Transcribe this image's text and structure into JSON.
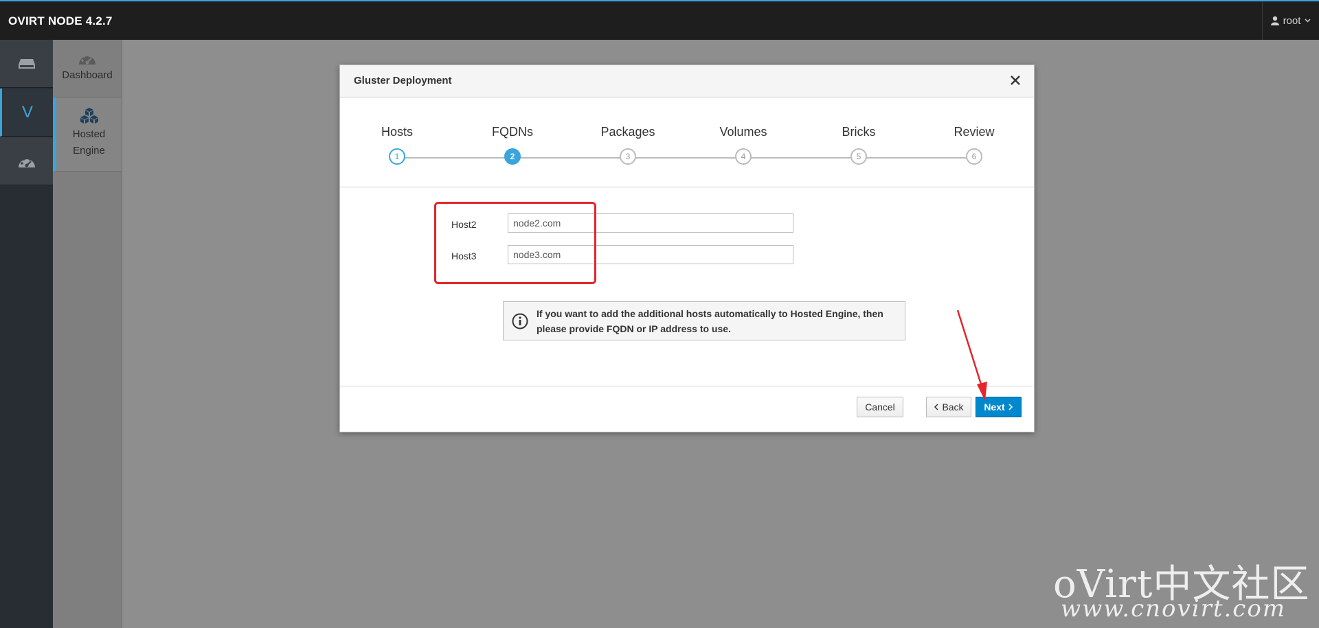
{
  "app": {
    "title": "OVIRT NODE 4.2.7",
    "user": "root"
  },
  "leftnav": {
    "items": [
      {
        "name": "host",
        "icon": "server-icon"
      },
      {
        "name": "virtualization",
        "label": "V"
      },
      {
        "name": "dashboard",
        "icon": "dashboard-icon"
      }
    ]
  },
  "subnav": {
    "items": [
      {
        "label": "Dashboard",
        "icon": "dashboard-icon"
      },
      {
        "label": "Hosted Engine",
        "line1": "Hosted",
        "line2": "Engine",
        "icon": "cubes-icon",
        "active": true
      }
    ]
  },
  "modal": {
    "title": "Gluster Deployment",
    "steps": [
      {
        "label": "Hosts",
        "number": "1",
        "state": "done"
      },
      {
        "label": "FQDNs",
        "number": "2",
        "state": "active"
      },
      {
        "label": "Packages",
        "number": "3",
        "state": "pending"
      },
      {
        "label": "Volumes",
        "number": "4",
        "state": "pending"
      },
      {
        "label": "Bricks",
        "number": "5",
        "state": "pending"
      },
      {
        "label": "Review",
        "number": "6",
        "state": "pending"
      }
    ],
    "fields": [
      {
        "label": "Host2",
        "value": "node2.com"
      },
      {
        "label": "Host3",
        "value": "node3.com"
      }
    ],
    "info": "If you want to add the additional hosts automatically to Hosted Engine, then please provide FQDN or IP address to use.",
    "buttons": {
      "cancel": "Cancel",
      "back": "Back",
      "next": "Next"
    }
  },
  "watermark": {
    "main": "oVirt中文社区",
    "url": "www.cnovirt.com"
  },
  "colors": {
    "accent": "#39a5dc",
    "primary_button": "#0088ce",
    "annotation": "#e3262b",
    "topbar": "#1e1e1e"
  }
}
